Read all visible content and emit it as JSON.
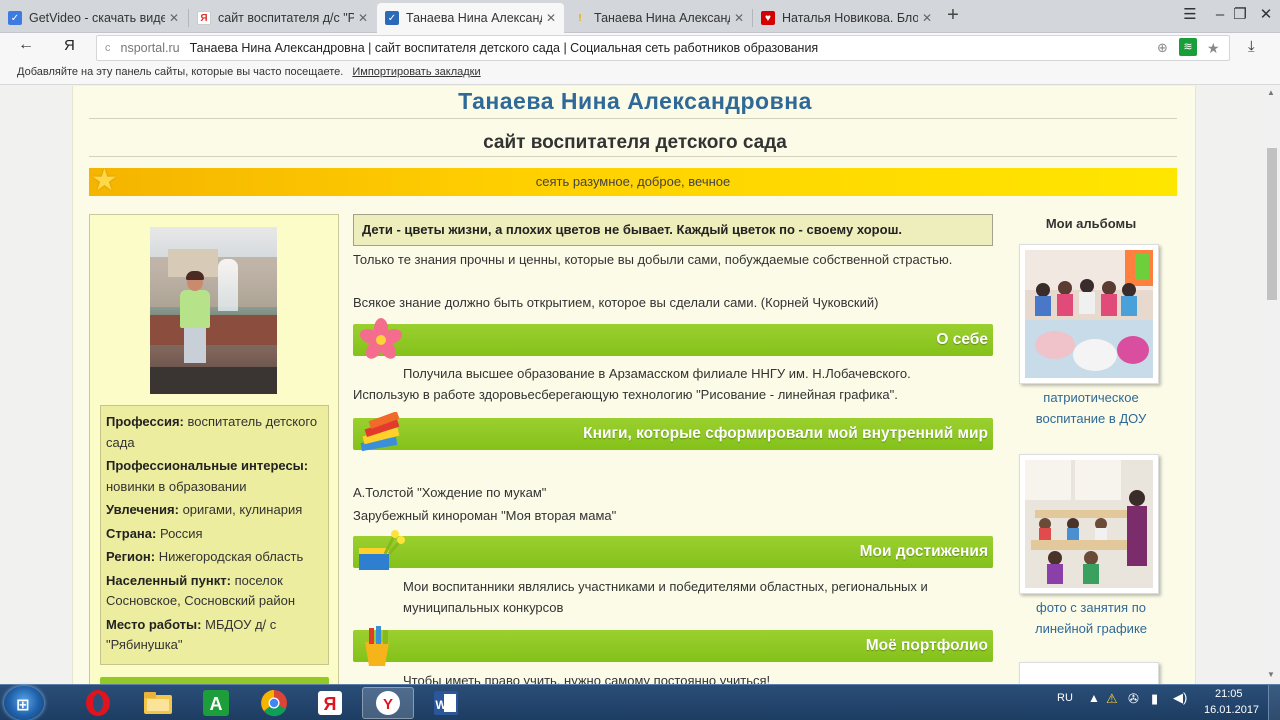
{
  "browser": {
    "tabs": [
      {
        "label": "GetVideo - скачать видео с",
        "fav_color": "#3d7be0",
        "fav_glyph": "✓"
      },
      {
        "label": "сайт воспитателя д/с \"Рябин",
        "fav_color": "#d33",
        "fav_glyph": "Я"
      },
      {
        "label": "Танаева Нина Александр",
        "fav_color": "#2a6ab8",
        "fav_glyph": "✓",
        "active": true
      },
      {
        "label": "Танаева Нина Александрова",
        "fav_color": "#f5c400",
        "fav_glyph": "!"
      },
      {
        "label": "Наталья Новикова. Блог - С",
        "fav_color": "#d40000",
        "fav_glyph": "♥"
      }
    ],
    "address_domain": "nsportal.ru",
    "address_title": "Танаева Нина Александровна | сайт воспитателя детского сада | Социальная сеть работников образования",
    "bookmarks_prompt": "Добавляйте на эту панель сайты, которые вы часто посещаете.",
    "bookmarks_import": "Импортировать закладки"
  },
  "page": {
    "name": "Танаева Нина Александровна",
    "subtitle": "сайт воспитателя детского сада",
    "motto": "сеять разумное, доброе, вечное",
    "profile": {
      "profession_label": "Профессия:",
      "profession_value": "воспитатель детского сада",
      "interests_label": "Профессиональные интересы:",
      "interests_value": "новинки в образовании",
      "hobbies_label": "Увлечения:",
      "hobbies_value": "оригами, кулинария",
      "country_label": "Страна:",
      "country_value": "Россия",
      "region_label": "Регион:",
      "region_value": "Нижегородская область",
      "locality_label": "Населенный пункт:",
      "locality_value": "поселок Сосновское, Сосновский район",
      "workplace_label": "Место работы:",
      "workplace_value": "МБДОУ д/ с \"Рябинушка\""
    },
    "quote": "Дети - цветы жизни, а плохих цветов не бывает. Каждый цветок по - своему хорош.",
    "intro_1": "Только те знания прочны и ценны, которые вы добыли сами, побуждаемые собственной страстью.",
    "intro_2": "Всякое знание должно быть открытием, которое вы сделали сами. (Корней Чуковский)",
    "about_title": "О себе",
    "about_1": "Получила высшее образование в Арзамасском филиале ННГУ им. Н.Лобачевского.",
    "about_2": "Использую в работе здоровьесберегающую технологию \"Рисование - линейная графика\".",
    "books_title": "Книги, которые сформировали мой внутренний мир",
    "book_1": "А.Толстой \"Хождение по мукам\"",
    "book_2": "Зарубежный кинороман \"Моя вторая мама\"",
    "achievements_title": "Мои достижения",
    "achievements_text": "Мои воспитанники являлись участниками и победителями областных, региональных и муниципальных  конкурсов",
    "portfolio_title": "Моё портфолио",
    "portfolio_text": "Чтобы иметь право учить, нужно самому постоянно учиться!",
    "albums_title": "Мои альбомы",
    "album_1": "патриотическое воспитание в ДОУ",
    "album_2": "фото с занятия по линейной графике"
  },
  "taskbar": {
    "lang": "RU",
    "time": "21:05",
    "date": "16.01.2017"
  }
}
